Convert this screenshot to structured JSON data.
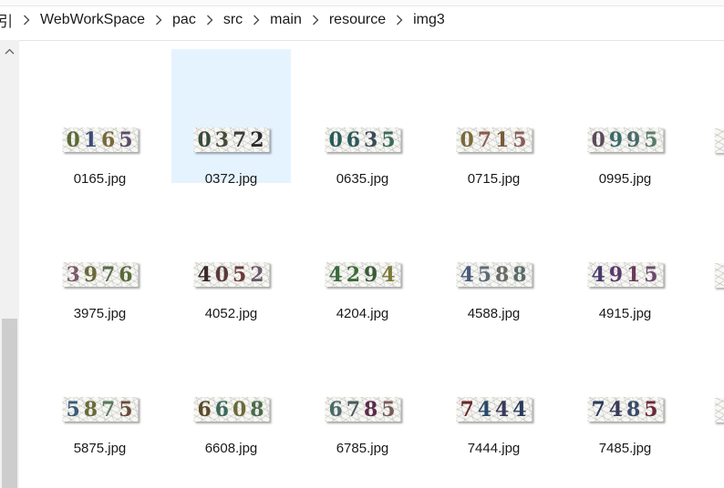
{
  "breadcrumb": {
    "partial_glyph": "引",
    "items": [
      "WebWorkSpace",
      "pac",
      "src",
      "main",
      "resource",
      "img3"
    ]
  },
  "files": [
    {
      "name": "0165.jpg",
      "code": "0165",
      "colors": [
        "#5a6a33",
        "#3a4a7a",
        "#7a6a3a",
        "#5a4a6a"
      ],
      "selected": false
    },
    {
      "name": "0372.jpg",
      "code": "0372",
      "colors": [
        "#3a4a3a",
        "#4a4a3a",
        "#3a3a3a",
        "#2a2a2a"
      ],
      "selected": true
    },
    {
      "name": "0635.jpg",
      "code": "0635",
      "colors": [
        "#2a5a5a",
        "#2a5a5a",
        "#3a4a5a",
        "#3a6a5a"
      ],
      "selected": false
    },
    {
      "name": "0715.jpg",
      "code": "0715",
      "colors": [
        "#7a6a3a",
        "#8a5a4a",
        "#7a5a3a",
        "#8a5a5a"
      ],
      "selected": false
    },
    {
      "name": "0995.jpg",
      "code": "0995",
      "colors": [
        "#5a4a5a",
        "#3a6a6a",
        "#4a6a6a",
        "#5a7a6a"
      ],
      "selected": false
    },
    {
      "name": "3975.jpg",
      "code": "3976",
      "colors": [
        "#7a5a6a",
        "#6a6a3a",
        "#5a6a4a",
        "#5a6a3a"
      ],
      "selected": false
    },
    {
      "name": "4052.jpg",
      "code": "4052",
      "colors": [
        "#3a2a2a",
        "#5a3a3a",
        "#6a3a3a",
        "#6a5a6a"
      ],
      "selected": false
    },
    {
      "name": "4204.jpg",
      "code": "4294",
      "colors": [
        "#3a6a3a",
        "#3a6a3a",
        "#3a5a3a",
        "#7a7a3a"
      ],
      "selected": false
    },
    {
      "name": "4588.jpg",
      "code": "4588",
      "colors": [
        "#4a5a7a",
        "#5a6a7a",
        "#6a6a6a",
        "#5a6a6a"
      ],
      "selected": false
    },
    {
      "name": "4915.jpg",
      "code": "4915",
      "colors": [
        "#4a3a6a",
        "#5a3a6a",
        "#6a3a5a",
        "#6a4a6a"
      ],
      "selected": false
    },
    {
      "name": "5875.jpg",
      "code": "5875",
      "colors": [
        "#3a5a7a",
        "#6a6a3a",
        "#5a7a5a",
        "#6a4a3a"
      ],
      "selected": false
    },
    {
      "name": "6608.jpg",
      "code": "6608",
      "colors": [
        "#5a4a2a",
        "#3a6a5a",
        "#6a6a3a",
        "#4a6a4a"
      ],
      "selected": false
    },
    {
      "name": "6785.jpg",
      "code": "6785",
      "colors": [
        "#4a6a6a",
        "#4a5a5a",
        "#5a2a4a",
        "#7a5a5a"
      ],
      "selected": false
    },
    {
      "name": "7444.jpg",
      "code": "7444",
      "colors": [
        "#6a2a2a",
        "#2a4a6a",
        "#3a3a5a",
        "#2a3a5a"
      ],
      "selected": false
    },
    {
      "name": "7485.jpg",
      "code": "7485",
      "colors": [
        "#2a3a5a",
        "#3a3a5a",
        "#3a4a6a",
        "#6a2a3a"
      ],
      "selected": false
    }
  ],
  "colors": {
    "selection_bg": "#e5f3ff",
    "scroll_track": "#f1f1f1",
    "scroll_thumb": "#cdcdcd"
  }
}
